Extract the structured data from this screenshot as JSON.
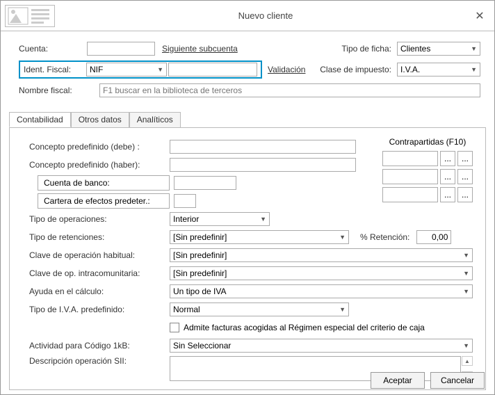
{
  "window": {
    "title": "Nuevo cliente"
  },
  "top": {
    "cuenta_lbl": "Cuenta:",
    "siguiente": "Siguiente subcuenta",
    "tipo_ficha_lbl": "Tipo de ficha:",
    "tipo_ficha_val": "Clientes",
    "ident_lbl": "Ident. Fiscal:",
    "ident_val": "NIF",
    "validacion": "Validación",
    "clase_imp_lbl": "Clase de impuesto:",
    "clase_imp_val": "I.V.A.",
    "nombre_lbl": "Nombre fiscal:",
    "nombre_ph": "F1 buscar en la biblioteca de terceros"
  },
  "tabs": {
    "t1": "Contabilidad",
    "t2": "Otros datos",
    "t3": "Analíticos"
  },
  "cont": {
    "cp_debe": "Concepto predefinido (debe) :",
    "cp_haber": "Concepto predefinido (haber):",
    "cuenta_banco": "Cuenta de banco:",
    "cartera": "Cartera de efectos predeter.:",
    "tipo_op_lbl": "Tipo de operaciones:",
    "tipo_op_val": "Interior",
    "tipo_ret_lbl": "Tipo de retenciones:",
    "tipo_ret_val": "[Sin predefinir]",
    "pct_ret_lbl": "% Retención:",
    "pct_ret_val": "0,00",
    "clave_hab_lbl": "Clave de operación habitual:",
    "clave_hab_val": "[Sin predefinir]",
    "clave_intra_lbl": "Clave de op. intracomunitaria:",
    "clave_intra_val": "[Sin predefinir]",
    "ayuda_lbl": "Ayuda en el cálculo:",
    "ayuda_val": "Un tipo de IVA",
    "iva_pred_lbl": "Tipo de I.V.A. predefinido:",
    "iva_pred_val": "Normal",
    "chk_lbl": "Admite facturas acogidas al Régimen especial del criterio de caja",
    "act_1kb_lbl": "Actividad para Código 1kB:",
    "act_1kb_val": "Sin Seleccionar",
    "desc_sii_lbl": "Descripción operación SII:",
    "contrap_hdr": "Contrapartidas (F10)",
    "ellipsis": "..."
  },
  "footer": {
    "ok": "Aceptar",
    "cancel": "Cancelar"
  }
}
